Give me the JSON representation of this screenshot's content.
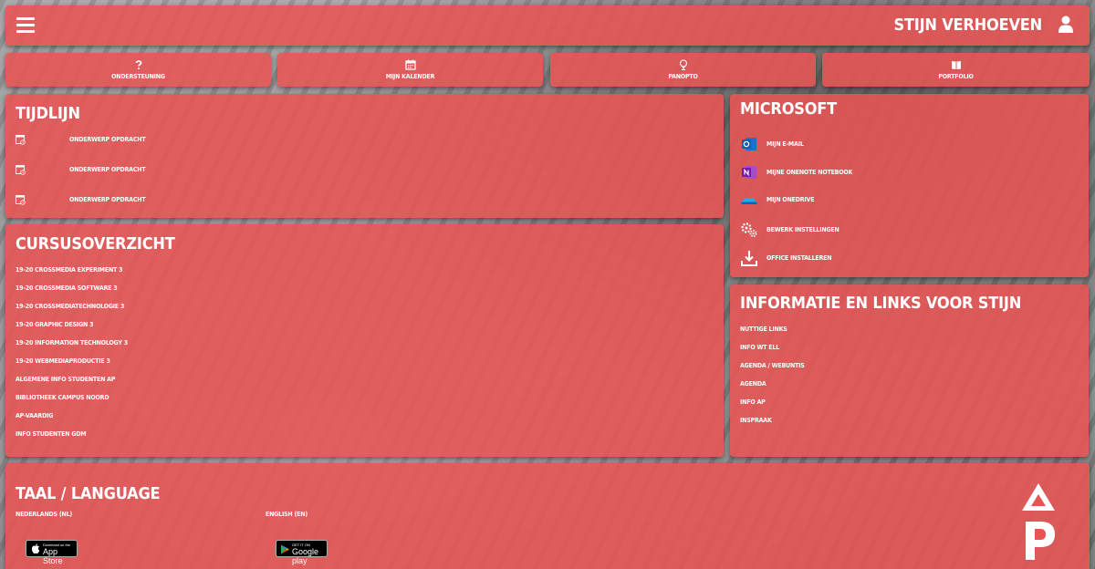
{
  "header": {
    "user_name": "STIJN VERHOEVEN"
  },
  "quick_links": [
    {
      "label": "ONDERSTEUNING",
      "icon": "question-icon"
    },
    {
      "label": "MIJN KALENDER",
      "icon": "calendar-icon"
    },
    {
      "label": "PANOPTO",
      "icon": "tree-icon"
    },
    {
      "label": "PORTFOLIO",
      "icon": "book-icon"
    }
  ],
  "tijdlijn": {
    "title": "TIJDLIJN",
    "items": [
      "ONDERWERP OPDRACHT",
      "ONDERWERP OPDRACHT",
      "ONDERWERP OPDRACHT"
    ]
  },
  "cursus": {
    "title": "CURSUSOVERZICHT",
    "items": [
      "19-20 CROSSMEDIA EXPERIMENT 3",
      "19-20 CROSSMEDIA SOFTWARE 3",
      "19-20 CROSSMEDIATECHNOLOGIE 3",
      "19-20 GRAPHIC DESIGN 3",
      "19-20 INFORMATION TECHNOLOGY 3",
      "19-20 WEBMEDIAPRODUCTIE 3",
      "ALGEMENE INFO STUDENTEN AP",
      "BIBLIOTHEEK CAMPUS NOORD",
      "AP-VAARDIG",
      "INFO STUDENTEN GDM"
    ]
  },
  "microsoft": {
    "title": "MICROSOFT",
    "items": [
      {
        "label": "MIJN E-MAIL",
        "icon": "outlook-icon"
      },
      {
        "label": "MIJNE ONENOTE NOTEBOOK",
        "icon": "onenote-icon"
      },
      {
        "label": "MIJN ONEDRIVE",
        "icon": "onedrive-icon"
      },
      {
        "label": "BEWERK INSTELLINGEN",
        "icon": "gears-icon"
      },
      {
        "label": "OFFICE INSTALLEREN",
        "icon": "download-icon"
      }
    ]
  },
  "info": {
    "title": "INFORMATIE EN LINKS VOOR STIJN",
    "items": [
      "NUTTIGE LINKS",
      "INFO WT ELL",
      "AGENDA / WEBUNTIS",
      "AGENDA",
      "INFO AP",
      "INSPRAAK"
    ]
  },
  "taal": {
    "title": "TAAL / LANGUAGE",
    "languages": [
      "NEDERLANDS (NL)",
      "ENGLISH (EN)"
    ],
    "app_store": {
      "sub": "Download on the",
      "main": "App Store"
    },
    "google_play": {
      "sub": "GET IT ON",
      "main": "Google play"
    }
  },
  "colors": {
    "card": "#e85454",
    "text": "#ffffff"
  }
}
